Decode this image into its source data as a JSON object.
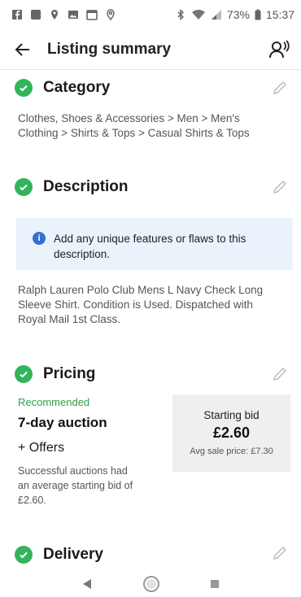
{
  "status": {
    "battery": "73%",
    "time": "15:37"
  },
  "header": {
    "title": "Listing summary"
  },
  "category": {
    "title": "Category",
    "path_line1": "Clothes, Shoes & Accessories > Men > Men's",
    "path_line2": "Clothing > Shirts & Tops > Casual Shirts & Tops"
  },
  "description": {
    "title": "Description",
    "info_line1": "Add any unique features or flaws to this",
    "info_line2": "description.",
    "text_line1": "Ralph Lauren Polo Club Mens L Navy Check Long",
    "text_line2": "Sleeve Shirt. Condition is Used. Dispatched with",
    "text_line3": "Royal Mail 1st Class."
  },
  "pricing": {
    "title": "Pricing",
    "recommended": "Recommended",
    "auction": "7-day auction",
    "offers": "+ Offers",
    "note_line1": "Successful auctions had",
    "note_line2": "an average starting bid of",
    "note_line3": "£2.60.",
    "bid_label": "Starting bid",
    "bid_value": "£2.60",
    "avg_label": "Avg sale price: £7.30"
  },
  "delivery": {
    "title": "Delivery"
  },
  "colors": {
    "green": "#32b45a",
    "info_bg": "#eaf2fb",
    "info_icon": "#2f6fd6"
  },
  "icons": [
    "back-arrow-icon",
    "person-voice-icon",
    "check-circle-icon",
    "pencil-icon",
    "info-icon"
  ]
}
